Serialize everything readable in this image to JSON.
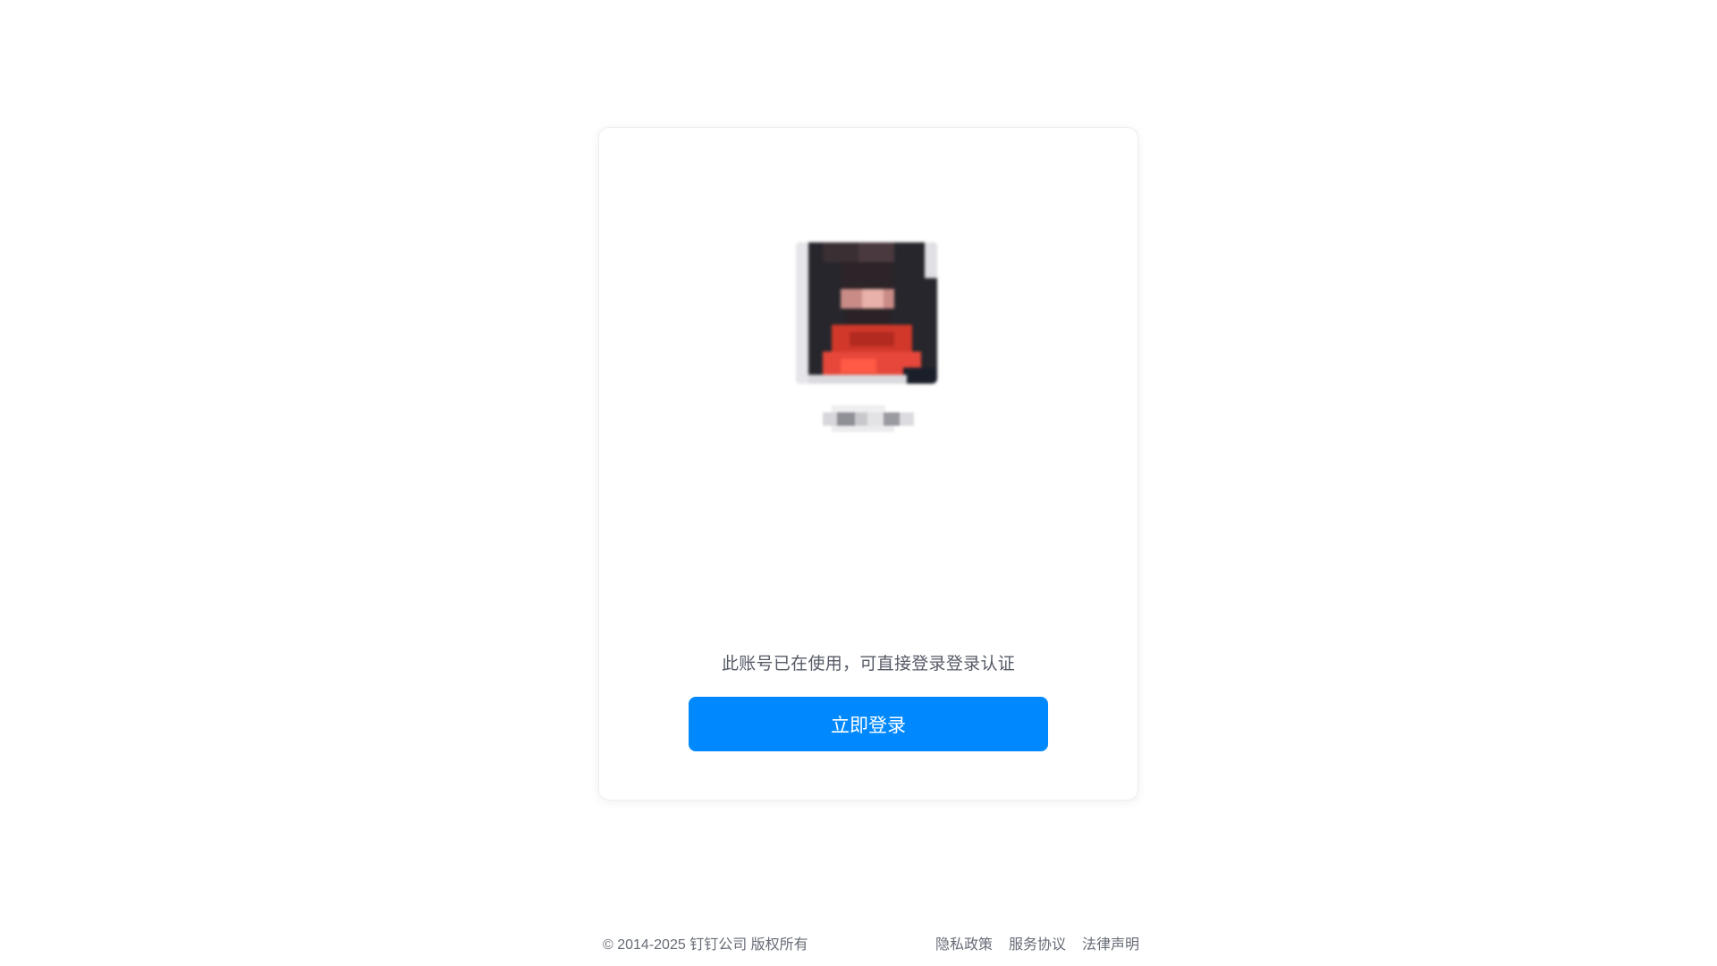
{
  "account": {
    "hint": "此账号已在使用，可直接登录登录认证",
    "login_button": "立即登录"
  },
  "footer": {
    "copyright": "© 2014-2025 钉钉公司 版权所有",
    "links": [
      "隐私政策",
      "服务协议",
      "法律声明"
    ]
  },
  "colors": {
    "primary": "#0089ff",
    "background": "#ffffff"
  }
}
